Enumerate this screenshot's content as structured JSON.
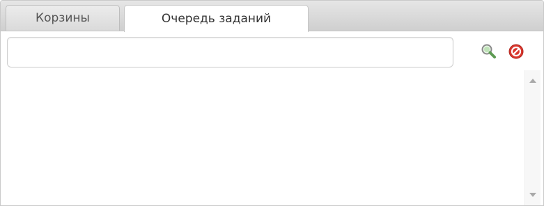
{
  "tabs": [
    {
      "label": "Корзины",
      "active": false
    },
    {
      "label": "Очередь заданий",
      "active": true
    }
  ],
  "search": {
    "value": "",
    "placeholder": ""
  },
  "icons": {
    "search": "magnifier-icon",
    "clear": "no-entry-icon"
  },
  "colors": {
    "magnifier_lens": "#9fcf9a",
    "clear_red": "#d9362d",
    "tab_bar": "#d8d8d8"
  }
}
